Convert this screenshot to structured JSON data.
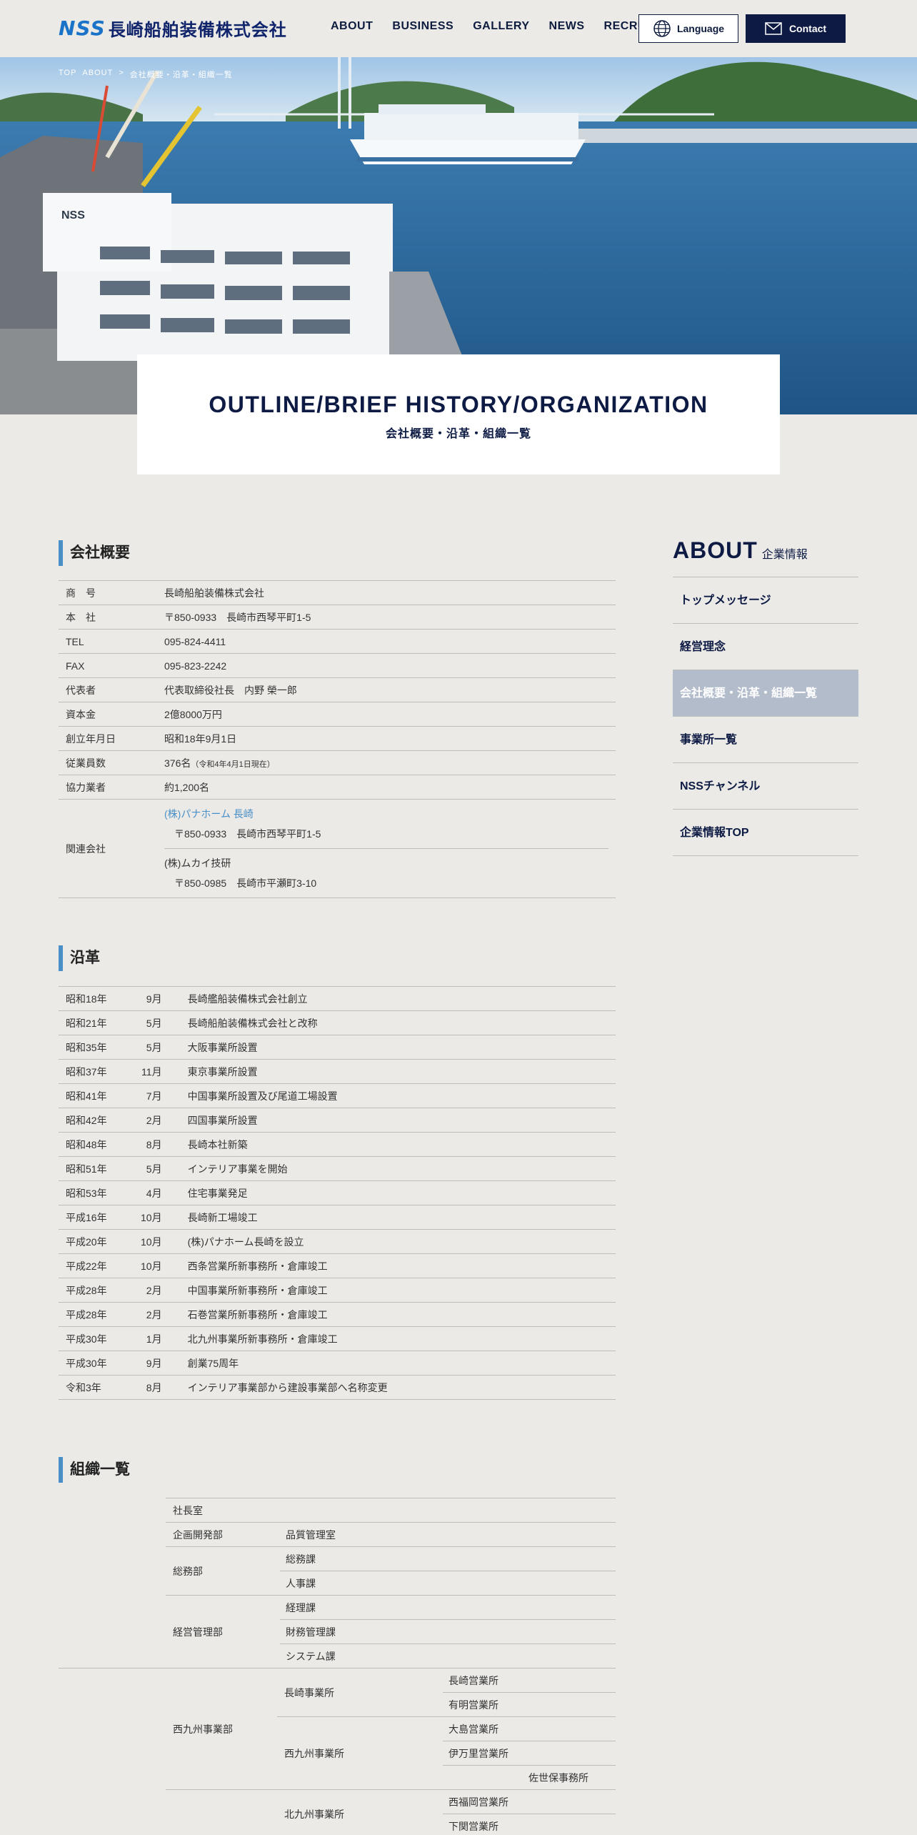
{
  "header": {
    "logo_mark": "NSS",
    "logo_text": "長崎船舶装備株式会社",
    "nav": [
      "ABOUT",
      "BUSINESS",
      "GALLERY",
      "NEWS",
      "RECRUIT"
    ],
    "language_label": "Language",
    "contact_label": "Contact"
  },
  "hero": {
    "breadcrumb": [
      "TOP",
      "ABOUT",
      ">",
      "会社概要・沿革・組織一覧"
    ],
    "building_sign": "NSS",
    "title_en": "OUTLINE/BRIEF HISTORY/ORGANIZATION",
    "title_ja": "会社概要・沿革・組織一覧"
  },
  "outline": {
    "heading": "会社概要",
    "rows": [
      {
        "key": "商　号",
        "value": "長崎船舶装備株式会社"
      },
      {
        "key": "本　社",
        "value": "〒850-0933　長崎市西琴平町1-5"
      },
      {
        "key": "TEL",
        "value": "095-824-4411"
      },
      {
        "key": "FAX",
        "value": "095-823-2242"
      },
      {
        "key": "代表者",
        "value": "代表取締役社長　内野 榮一郎"
      },
      {
        "key": "資本金",
        "value": "2億8000万円"
      },
      {
        "key": "創立年月日",
        "value": "昭和18年9月1日"
      },
      {
        "key": "従業員数",
        "value": "376名",
        "note": "（令和4年4月1日現在）"
      },
      {
        "key": "協力業者",
        "value": "約1,200名"
      }
    ],
    "related": {
      "key": "関連会社",
      "companies": [
        {
          "name": "(株)パナホーム 長崎",
          "address": "〒850-0933　長崎市西琴平町1-5"
        },
        {
          "name": "(株)ムカイ技研",
          "address": "〒850-0985　長崎市平瀬町3-10"
        }
      ]
    }
  },
  "history": {
    "heading": "沿革",
    "rows": [
      {
        "year": "昭和18年",
        "month": "9月",
        "event": "長崎艦船装備株式会社創立"
      },
      {
        "year": "昭和21年",
        "month": "5月",
        "event": "長崎船舶装備株式会社と改称"
      },
      {
        "year": "昭和35年",
        "month": "5月",
        "event": "大阪事業所設置"
      },
      {
        "year": "昭和37年",
        "month": "11月",
        "event": "東京事業所設置"
      },
      {
        "year": "昭和41年",
        "month": "7月",
        "event": "中国事業所設置及び尾道工場設置"
      },
      {
        "year": "昭和42年",
        "month": "2月",
        "event": "四国事業所設置"
      },
      {
        "year": "昭和48年",
        "month": "8月",
        "event": "長崎本社新築"
      },
      {
        "year": "昭和51年",
        "month": "5月",
        "event": "インテリア事業を開始"
      },
      {
        "year": "昭和53年",
        "month": "4月",
        "event": "住宅事業発足"
      },
      {
        "year": "平成16年",
        "month": "10月",
        "event": "長崎新工場竣工"
      },
      {
        "year": "平成20年",
        "month": "10月",
        "event": "(株)パナホーム長崎を設立"
      },
      {
        "year": "平成22年",
        "month": "10月",
        "event": "西条営業所新事務所・倉庫竣工"
      },
      {
        "year": "平成28年",
        "month": "2月",
        "event": "中国事業所新事務所・倉庫竣工"
      },
      {
        "year": "平成28年",
        "month": "2月",
        "event": "石巻営業所新事務所・倉庫竣工"
      },
      {
        "year": "平成30年",
        "month": "1月",
        "event": "北九州事業所新事務所・倉庫竣工"
      },
      {
        "year": "平成30年",
        "month": "9月",
        "event": "創業75周年"
      },
      {
        "year": "令和3年",
        "month": "8月",
        "event": "インテリア事業部から建設事業部へ名称変更"
      }
    ]
  },
  "organization": {
    "heading": "組織一覧",
    "president_office": "社長室",
    "planning": "企画開発部",
    "quality": "品質管理室",
    "general_affairs": "総務部",
    "general_sections": [
      "総務課",
      "人事課"
    ],
    "management": "経営管理部",
    "management_sections": [
      "経理課",
      "財務管理課",
      "システム課"
    ],
    "west_kyushu": "西九州事業部",
    "nagasaki_office": "長崎事業所",
    "nagasaki_branches": [
      "長崎営業所",
      "有明営業所"
    ],
    "west_office": "西九州事業所",
    "west_branches": [
      "大島営業所",
      "伊万里営業所",
      "佐世保事務所"
    ],
    "kitakyushu_office": "北九州事業所",
    "kitakyushu_branches": [
      "西福岡営業所",
      "下関営業所"
    ]
  },
  "sidebar": {
    "title_en": "ABOUT",
    "title_ja": "企業情報",
    "items": [
      "トップメッセージ",
      "経営理念",
      "会社概要・沿革・組織一覧",
      "事業所一覧",
      "NSSチャンネル",
      "企業情報TOP"
    ],
    "active_index": 2
  },
  "colors": {
    "navy": "#0d1b44",
    "accent_blue": "#4a90c8",
    "background": "#ebeae6",
    "active_menu": "#b3bccb"
  }
}
